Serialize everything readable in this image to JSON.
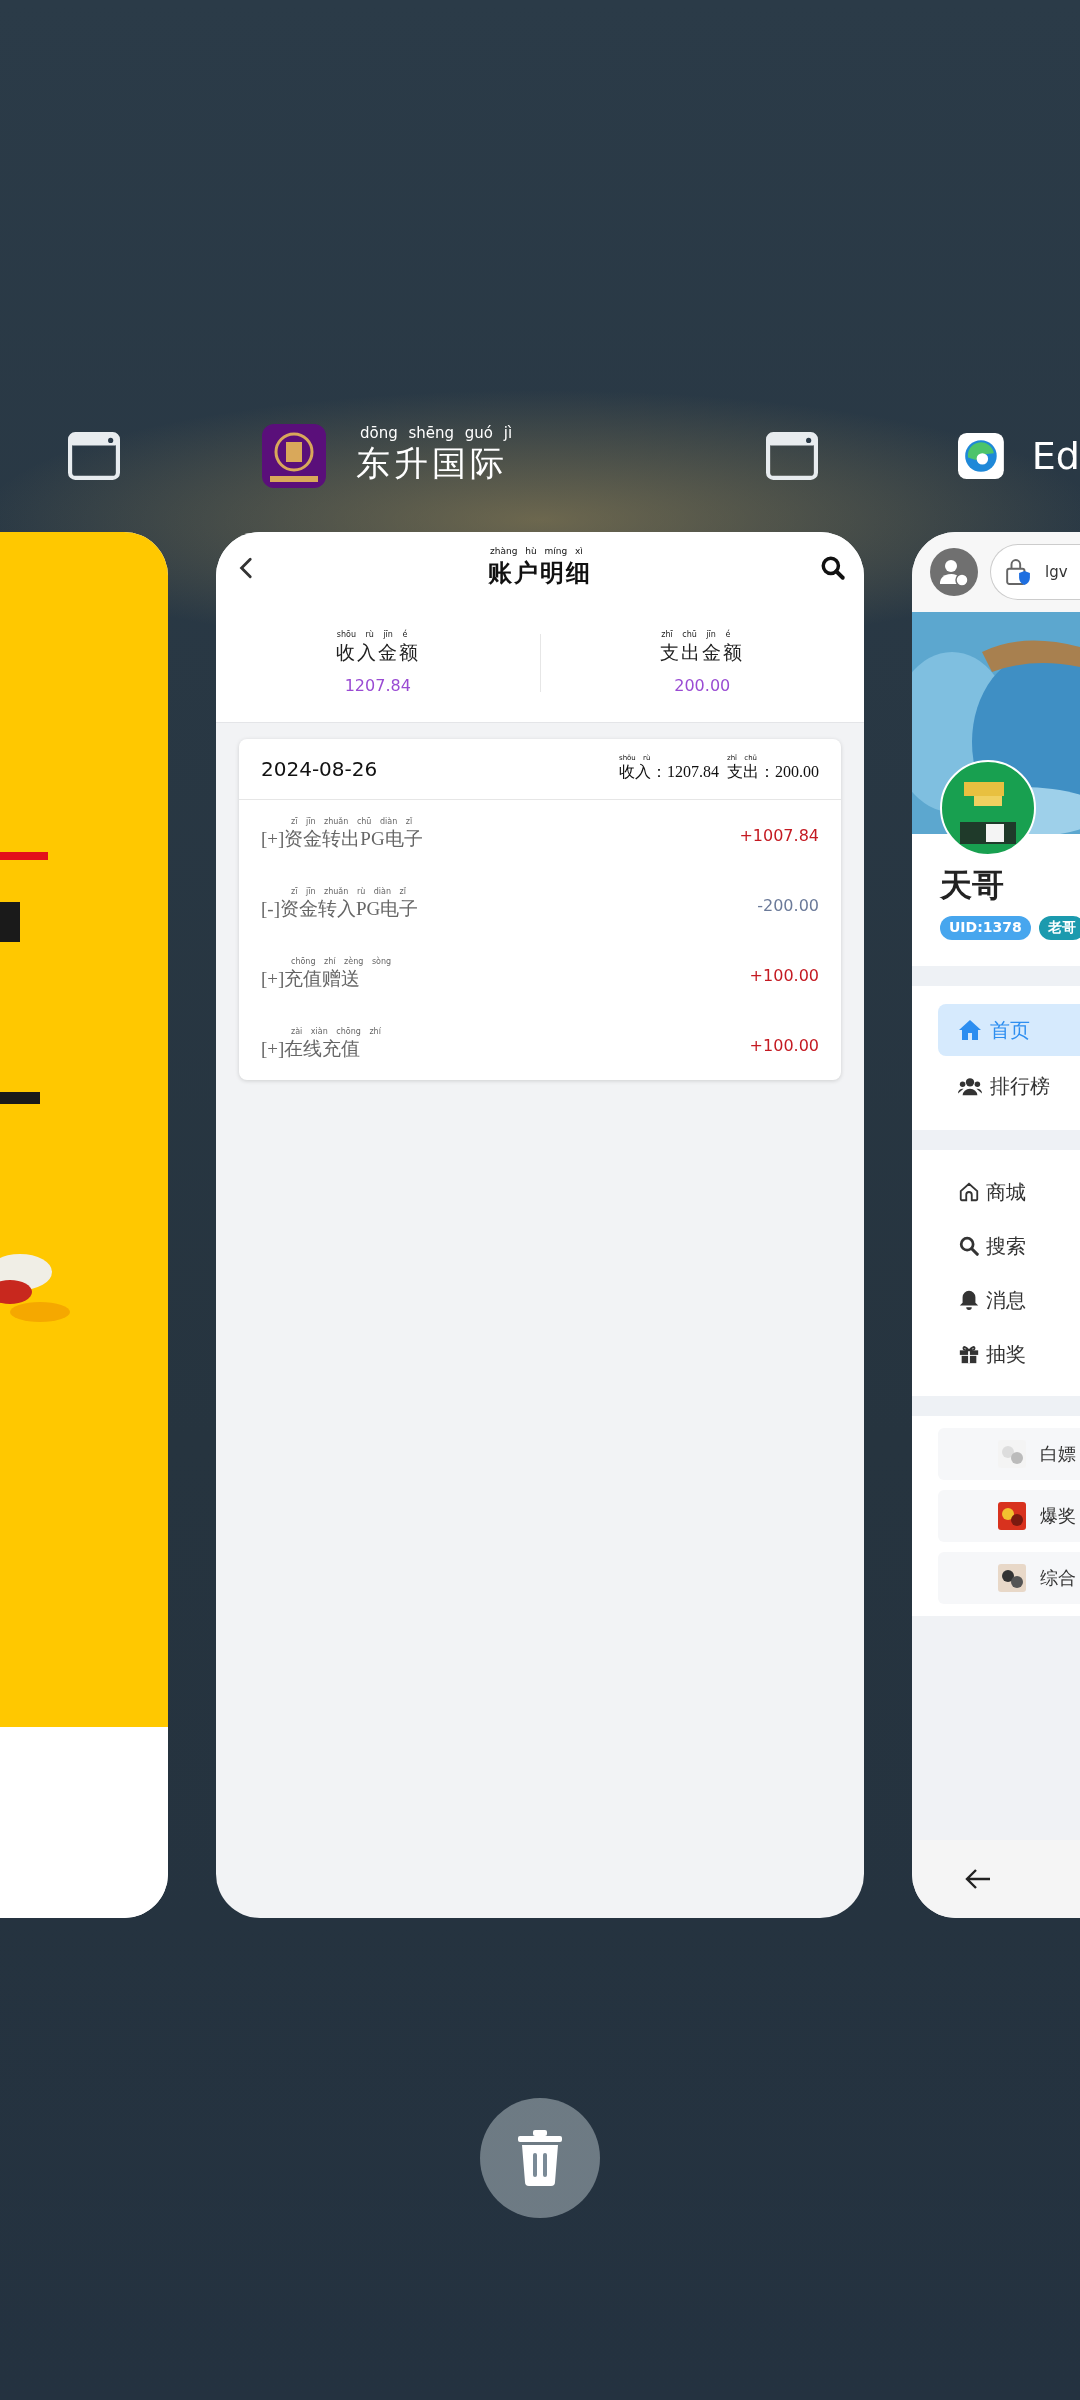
{
  "middle_app": {
    "name": {
      "pinyin": "dōng shēng guó jì",
      "text": "东升国际"
    },
    "title": {
      "pinyin": "zhàng hù míng xì",
      "text": "账户明细"
    },
    "income": {
      "pinyin": "shōu rù jīn é",
      "label": "收入金额",
      "value": "1207.84"
    },
    "expense": {
      "pinyin": "zhī chū jīn é",
      "label": "支出金额",
      "value": "200.00"
    },
    "day": {
      "date": "2024-08-26",
      "income": {
        "pinyin": "shōu rù",
        "text": "收入：1207.84"
      },
      "expense": {
        "pinyin": "zhī chū",
        "text": "支出：200.00"
      }
    },
    "entries": [
      {
        "pinyin": "zī jīn zhuǎn chū diàn zǐ",
        "label": "[+]资金转出PG电子",
        "amount": "+1007.84",
        "kind": "credit"
      },
      {
        "pinyin": "zī jīn zhuǎn rù diàn zǐ",
        "label": "[-]资金转入PG电子",
        "amount": "-200.00",
        "kind": "debit"
      },
      {
        "pinyin": "chōng zhí zèng sòng",
        "label": "[+]充值赠送",
        "amount": "+100.00",
        "kind": "credit"
      },
      {
        "pinyin": "zài xiàn chōng zhí",
        "label": "[+]在线充值",
        "amount": "+100.00",
        "kind": "credit"
      }
    ]
  },
  "right_app": {
    "name": "Ed",
    "address": "lgv",
    "user": "天哥",
    "badges": [
      {
        "text": "UID:1378",
        "color": "#47a6ee"
      },
      {
        "text": "老哥",
        "color": "#1b9aae"
      }
    ],
    "nav": [
      {
        "label": "首页",
        "kind": "home",
        "selected": true
      },
      {
        "label": "排行榜",
        "kind": "users",
        "selected": false
      }
    ],
    "links": [
      {
        "label": "商城",
        "kind": "home"
      },
      {
        "label": "搜索",
        "kind": "search"
      },
      {
        "label": "消息",
        "kind": "bell"
      },
      {
        "label": "抽奖",
        "kind": "gift"
      }
    ],
    "categories": [
      {
        "label": "白嫖"
      },
      {
        "label": "爆奖"
      },
      {
        "label": "综合"
      }
    ]
  }
}
